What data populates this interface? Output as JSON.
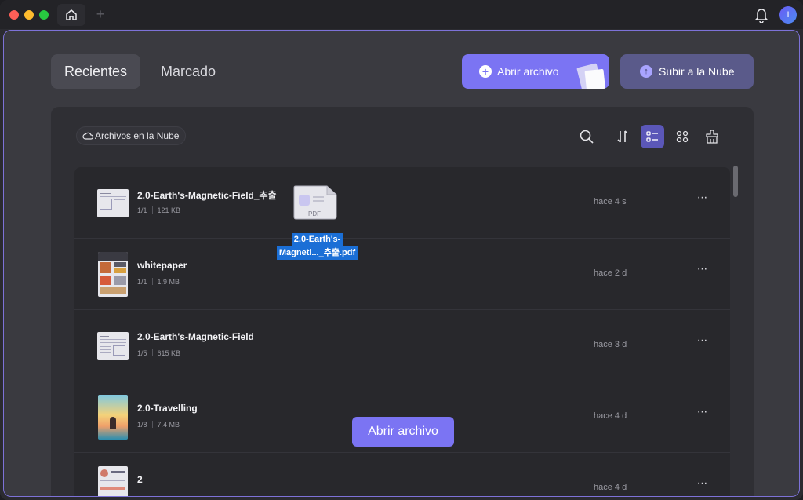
{
  "window": {
    "title_tabs": {
      "home_icon": "home-icon",
      "new_tab_label": "+"
    },
    "avatar_initial": "I"
  },
  "tabs": [
    {
      "label": "Recientes",
      "active": true
    },
    {
      "label": "Marcado",
      "active": false
    }
  ],
  "actions": {
    "open_file": "Abrir archivo",
    "upload_cloud": "Subir a la Nube"
  },
  "toolbar": {
    "cloud_files": "Archivos en la Nube",
    "icons": [
      "search-icon",
      "sort-icon",
      "list-view-icon",
      "grid-view-icon",
      "clear-icon"
    ],
    "active_view": "list"
  },
  "files": [
    {
      "name": "2.0-Earth's-Magnetic-Field_추출",
      "pages": "1/1",
      "size": "121 KB",
      "time": "hace 4 s"
    },
    {
      "name": "whitepaper",
      "pages": "1/1",
      "size": "1.9 MB",
      "time": "hace 2 d"
    },
    {
      "name": "2.0-Earth's-Magnetic-Field",
      "pages": "1/5",
      "size": "615 KB",
      "time": "hace 3 d"
    },
    {
      "name": "2.0-Travelling",
      "pages": "1/8",
      "size": "7.4 MB",
      "time": "hace 4 d"
    },
    {
      "name": "2",
      "pages": "",
      "size": "",
      "time": "hace 4 d"
    }
  ],
  "drag": {
    "icon_label": "PDF",
    "line1": "2.0-Earth's-",
    "line2": "Magneti..._추출.pdf"
  },
  "tooltip": "Abrir archivo",
  "colors": {
    "accent": "#7b74f3",
    "cloud_button": "#5a5a8a",
    "selection": "#1b6fd6"
  }
}
